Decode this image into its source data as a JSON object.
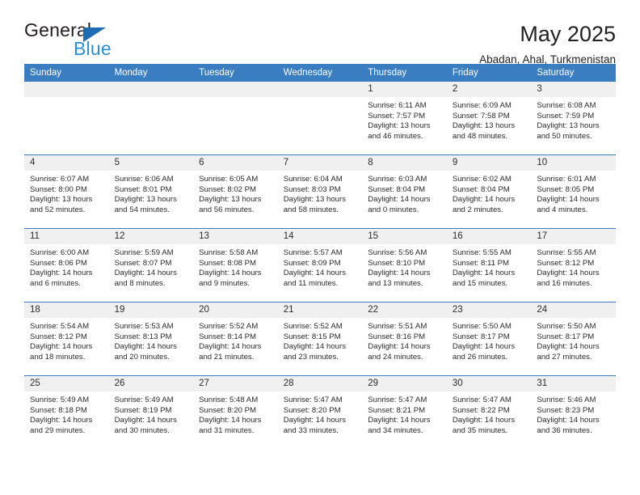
{
  "brand": {
    "name_part1": "General",
    "name_part2": "Blue",
    "accent_color": "#1d6cb3",
    "accent_color_light": "#2a8fd6"
  },
  "header": {
    "month_title": "May 2025",
    "location": "Abadan, Ahal, Turkmenistan"
  },
  "calendar": {
    "header_bg": "#3a7dc0",
    "daynum_bg": "#f0f0f0",
    "weekdays": [
      "Sunday",
      "Monday",
      "Tuesday",
      "Wednesday",
      "Thursday",
      "Friday",
      "Saturday"
    ],
    "weeks": [
      [
        {
          "day": "",
          "empty": true
        },
        {
          "day": "",
          "empty": true
        },
        {
          "day": "",
          "empty": true
        },
        {
          "day": "",
          "empty": true
        },
        {
          "day": "1",
          "sunrise": "Sunrise: 6:11 AM",
          "sunset": "Sunset: 7:57 PM",
          "daylight1": "Daylight: 13 hours",
          "daylight2": "and 46 minutes."
        },
        {
          "day": "2",
          "sunrise": "Sunrise: 6:09 AM",
          "sunset": "Sunset: 7:58 PM",
          "daylight1": "Daylight: 13 hours",
          "daylight2": "and 48 minutes."
        },
        {
          "day": "3",
          "sunrise": "Sunrise: 6:08 AM",
          "sunset": "Sunset: 7:59 PM",
          "daylight1": "Daylight: 13 hours",
          "daylight2": "and 50 minutes."
        }
      ],
      [
        {
          "day": "4",
          "sunrise": "Sunrise: 6:07 AM",
          "sunset": "Sunset: 8:00 PM",
          "daylight1": "Daylight: 13 hours",
          "daylight2": "and 52 minutes."
        },
        {
          "day": "5",
          "sunrise": "Sunrise: 6:06 AM",
          "sunset": "Sunset: 8:01 PM",
          "daylight1": "Daylight: 13 hours",
          "daylight2": "and 54 minutes."
        },
        {
          "day": "6",
          "sunrise": "Sunrise: 6:05 AM",
          "sunset": "Sunset: 8:02 PM",
          "daylight1": "Daylight: 13 hours",
          "daylight2": "and 56 minutes."
        },
        {
          "day": "7",
          "sunrise": "Sunrise: 6:04 AM",
          "sunset": "Sunset: 8:03 PM",
          "daylight1": "Daylight: 13 hours",
          "daylight2": "and 58 minutes."
        },
        {
          "day": "8",
          "sunrise": "Sunrise: 6:03 AM",
          "sunset": "Sunset: 8:04 PM",
          "daylight1": "Daylight: 14 hours",
          "daylight2": "and 0 minutes."
        },
        {
          "day": "9",
          "sunrise": "Sunrise: 6:02 AM",
          "sunset": "Sunset: 8:04 PM",
          "daylight1": "Daylight: 14 hours",
          "daylight2": "and 2 minutes."
        },
        {
          "day": "10",
          "sunrise": "Sunrise: 6:01 AM",
          "sunset": "Sunset: 8:05 PM",
          "daylight1": "Daylight: 14 hours",
          "daylight2": "and 4 minutes."
        }
      ],
      [
        {
          "day": "11",
          "sunrise": "Sunrise: 6:00 AM",
          "sunset": "Sunset: 8:06 PM",
          "daylight1": "Daylight: 14 hours",
          "daylight2": "and 6 minutes."
        },
        {
          "day": "12",
          "sunrise": "Sunrise: 5:59 AM",
          "sunset": "Sunset: 8:07 PM",
          "daylight1": "Daylight: 14 hours",
          "daylight2": "and 8 minutes."
        },
        {
          "day": "13",
          "sunrise": "Sunrise: 5:58 AM",
          "sunset": "Sunset: 8:08 PM",
          "daylight1": "Daylight: 14 hours",
          "daylight2": "and 9 minutes."
        },
        {
          "day": "14",
          "sunrise": "Sunrise: 5:57 AM",
          "sunset": "Sunset: 8:09 PM",
          "daylight1": "Daylight: 14 hours",
          "daylight2": "and 11 minutes."
        },
        {
          "day": "15",
          "sunrise": "Sunrise: 5:56 AM",
          "sunset": "Sunset: 8:10 PM",
          "daylight1": "Daylight: 14 hours",
          "daylight2": "and 13 minutes."
        },
        {
          "day": "16",
          "sunrise": "Sunrise: 5:55 AM",
          "sunset": "Sunset: 8:11 PM",
          "daylight1": "Daylight: 14 hours",
          "daylight2": "and 15 minutes."
        },
        {
          "day": "17",
          "sunrise": "Sunrise: 5:55 AM",
          "sunset": "Sunset: 8:12 PM",
          "daylight1": "Daylight: 14 hours",
          "daylight2": "and 16 minutes."
        }
      ],
      [
        {
          "day": "18",
          "sunrise": "Sunrise: 5:54 AM",
          "sunset": "Sunset: 8:12 PM",
          "daylight1": "Daylight: 14 hours",
          "daylight2": "and 18 minutes."
        },
        {
          "day": "19",
          "sunrise": "Sunrise: 5:53 AM",
          "sunset": "Sunset: 8:13 PM",
          "daylight1": "Daylight: 14 hours",
          "daylight2": "and 20 minutes."
        },
        {
          "day": "20",
          "sunrise": "Sunrise: 5:52 AM",
          "sunset": "Sunset: 8:14 PM",
          "daylight1": "Daylight: 14 hours",
          "daylight2": "and 21 minutes."
        },
        {
          "day": "21",
          "sunrise": "Sunrise: 5:52 AM",
          "sunset": "Sunset: 8:15 PM",
          "daylight1": "Daylight: 14 hours",
          "daylight2": "and 23 minutes."
        },
        {
          "day": "22",
          "sunrise": "Sunrise: 5:51 AM",
          "sunset": "Sunset: 8:16 PM",
          "daylight1": "Daylight: 14 hours",
          "daylight2": "and 24 minutes."
        },
        {
          "day": "23",
          "sunrise": "Sunrise: 5:50 AM",
          "sunset": "Sunset: 8:17 PM",
          "daylight1": "Daylight: 14 hours",
          "daylight2": "and 26 minutes."
        },
        {
          "day": "24",
          "sunrise": "Sunrise: 5:50 AM",
          "sunset": "Sunset: 8:17 PM",
          "daylight1": "Daylight: 14 hours",
          "daylight2": "and 27 minutes."
        }
      ],
      [
        {
          "day": "25",
          "sunrise": "Sunrise: 5:49 AM",
          "sunset": "Sunset: 8:18 PM",
          "daylight1": "Daylight: 14 hours",
          "daylight2": "and 29 minutes."
        },
        {
          "day": "26",
          "sunrise": "Sunrise: 5:49 AM",
          "sunset": "Sunset: 8:19 PM",
          "daylight1": "Daylight: 14 hours",
          "daylight2": "and 30 minutes."
        },
        {
          "day": "27",
          "sunrise": "Sunrise: 5:48 AM",
          "sunset": "Sunset: 8:20 PM",
          "daylight1": "Daylight: 14 hours",
          "daylight2": "and 31 minutes."
        },
        {
          "day": "28",
          "sunrise": "Sunrise: 5:47 AM",
          "sunset": "Sunset: 8:20 PM",
          "daylight1": "Daylight: 14 hours",
          "daylight2": "and 33 minutes."
        },
        {
          "day": "29",
          "sunrise": "Sunrise: 5:47 AM",
          "sunset": "Sunset: 8:21 PM",
          "daylight1": "Daylight: 14 hours",
          "daylight2": "and 34 minutes."
        },
        {
          "day": "30",
          "sunrise": "Sunrise: 5:47 AM",
          "sunset": "Sunset: 8:22 PM",
          "daylight1": "Daylight: 14 hours",
          "daylight2": "and 35 minutes."
        },
        {
          "day": "31",
          "sunrise": "Sunrise: 5:46 AM",
          "sunset": "Sunset: 8:23 PM",
          "daylight1": "Daylight: 14 hours",
          "daylight2": "and 36 minutes."
        }
      ]
    ]
  }
}
